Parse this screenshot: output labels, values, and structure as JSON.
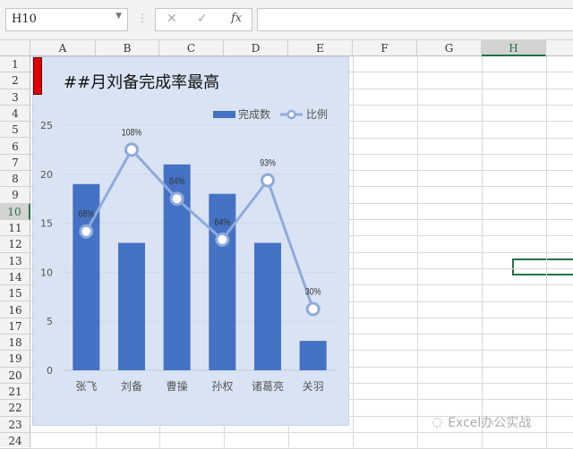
{
  "formula_bar": {
    "name_box": "H10",
    "cancel_icon": "✕",
    "confirm_icon": "✓",
    "fx_label": "fx",
    "formula": ""
  },
  "columns": [
    "A",
    "B",
    "C",
    "D",
    "E",
    "F",
    "G",
    "H"
  ],
  "rows": [
    "1",
    "2",
    "3",
    "4",
    "5",
    "6",
    "7",
    "8",
    "9",
    "10",
    "11",
    "12",
    "13",
    "14",
    "15",
    "16",
    "17",
    "18",
    "19",
    "20",
    "21",
    "22",
    "23",
    "24"
  ],
  "selected": {
    "column": "H",
    "row": "10"
  },
  "chart_data": {
    "type": "bar",
    "title": "##月刘备完成率最高",
    "categories": [
      "张飞",
      "刘备",
      "曹操",
      "孙权",
      "诸葛亮",
      "关羽"
    ],
    "series": [
      {
        "name": "完成数",
        "type": "bar",
        "values": [
          19,
          13,
          21,
          18,
          13,
          3
        ],
        "color": "#4472c4"
      },
      {
        "name": "比例",
        "type": "line",
        "axis": "secondary",
        "values": [
          0.68,
          1.08,
          0.84,
          0.64,
          0.93,
          0.3
        ],
        "labels": [
          "68%",
          "108%",
          "84%",
          "64%",
          "93%",
          "30%"
        ],
        "color": "#8faadc"
      }
    ],
    "ylim": [
      0,
      25
    ],
    "yticks": [
      "0",
      "5",
      "10",
      "15",
      "20",
      "25"
    ],
    "y2lim": [
      0,
      1.2
    ],
    "legend": "top-right",
    "grid": true
  },
  "watermark": "Excel办公实战"
}
